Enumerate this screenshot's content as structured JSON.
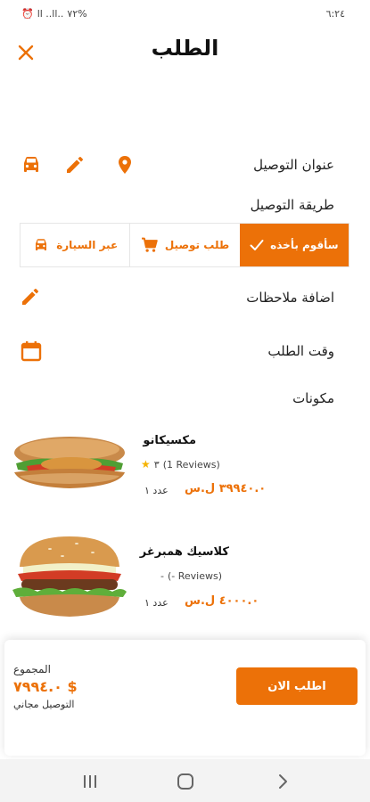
{
  "status_bar": {
    "time": "٦:٢٤",
    "battery": "%٧٢",
    "signal": "..ll ..ll"
  },
  "header": {
    "title": "الطلب"
  },
  "delivery_address": {
    "label": "عنوان التوصيل"
  },
  "delivery_method": {
    "label": "طريقة التوصيل",
    "options": [
      {
        "label": "سأقوم بأخذه",
        "icon": "check-icon",
        "selected": true
      },
      {
        "label": "طلب توصيل",
        "icon": "cart-icon",
        "selected": false
      },
      {
        "label": "عبر السيارة",
        "icon": "car-icon",
        "selected": false
      }
    ]
  },
  "notes": {
    "label": "اضافة ملاحظات"
  },
  "order_time": {
    "label": "وقت الطلب"
  },
  "ingredients": {
    "label": "مكونات"
  },
  "products": [
    {
      "name": "مكسيكانو",
      "rating": "٣",
      "reviews": "(1 Reviews)",
      "price": "٣٩٩٤٠.٠ ل.س",
      "qty": "عدد ١"
    },
    {
      "name": "كلاسيك همبرغر",
      "rating": "-",
      "reviews": "(- Reviews)",
      "price": "٤٠٠٠.٠ ل.س",
      "qty": "عدد ١"
    }
  ],
  "footer": {
    "total_label": "المجموع",
    "total_value": "$ ٧٩٩٤.٠",
    "delivery_note": "التوصيل مجاني",
    "order_button": "اطلب الان"
  },
  "colors": {
    "accent": "#ec7108"
  }
}
